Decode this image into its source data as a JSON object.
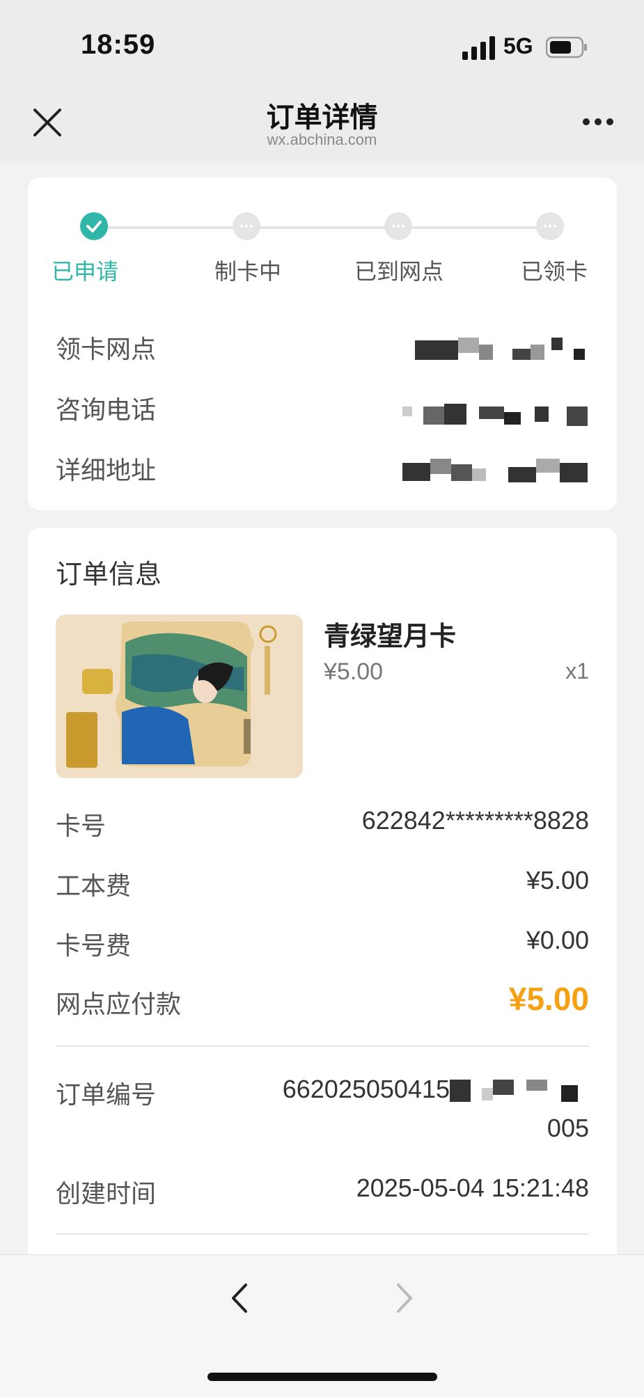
{
  "status_bar": {
    "time": "18:59",
    "network": "5G"
  },
  "header": {
    "title": "订单详情",
    "domain": "wx.abchina.com"
  },
  "progress": {
    "steps": [
      "已申请",
      "制卡中",
      "已到网点",
      "已领卡"
    ],
    "current_index": 0
  },
  "branch_info": {
    "pickup_branch_label": "领卡网点",
    "phone_label": "咨询电话",
    "address_label": "详细地址"
  },
  "order": {
    "section_title": "订单信息",
    "product_name": "青绿望月卡",
    "product_price": "¥5.00",
    "quantity": "x1",
    "card_number_label": "卡号",
    "card_number": "622842*********8828",
    "cost_fee_label": "工本费",
    "cost_fee": "¥5.00",
    "number_fee_label": "卡号费",
    "number_fee": "¥0.00",
    "payable_label": "网点应付款",
    "payable": "¥5.00",
    "order_no_label": "订单编号",
    "order_no_visible": "662025050415",
    "order_no_suffix": "005",
    "created_label": "创建时间",
    "created_time": "2025-05-04 15:21:48"
  },
  "colors": {
    "accent": "#2fb6a8",
    "price": "#f6a013"
  }
}
